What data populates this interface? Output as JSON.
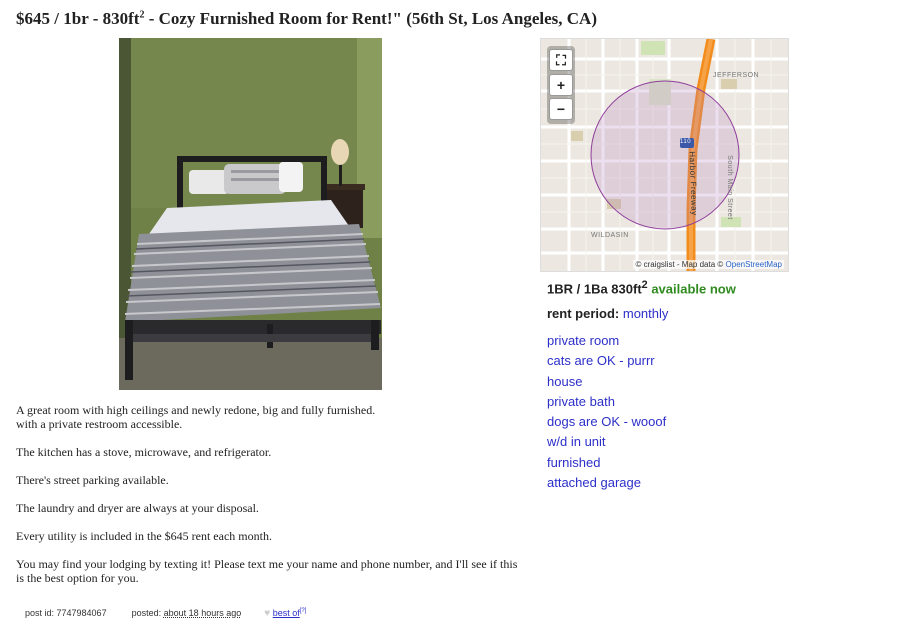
{
  "title": {
    "price": "$645",
    "rooms": "1br",
    "size": "830ft",
    "size_sup": "2",
    "name": "Cozy Furnished Room for Rent!\"",
    "location": "(56th St, Los Angeles, CA)"
  },
  "map": {
    "expand_icon": "⛶",
    "zoom_in": "+",
    "zoom_out": "−",
    "labels": {
      "jefferson": "JEFFERSON",
      "highway": "Harbor Freeway",
      "shield": "110",
      "main_street": "South Main Street",
      "wildasin": "WILDASIN"
    },
    "attribution_prefix": "© craigslist - Map data ©",
    "attribution_link": "OpenStreetMap"
  },
  "attrs": {
    "main": "1BR / 1Ba 830ft",
    "main_sup": "2",
    "availability": "available now",
    "rent_label": "rent period:",
    "rent_value": "monthly",
    "items": [
      "private room",
      "cats are OK - purrr",
      "house",
      "private bath",
      "dogs are OK - wooof",
      "w/d in unit",
      "furnished",
      "attached garage"
    ]
  },
  "body": {
    "p1_line1": "A great room with high ceilings and newly redone, big and fully furnished.",
    "p1_line2": "with a private restroom accessible.",
    "p2": "The kitchen has a stove, microwave, and refrigerator.",
    "p3": "There's street parking available.",
    "p4": "The laundry and dryer are always at your disposal.",
    "p5": "Every utility is included in the $645 rent each month.",
    "p6": "You may find your lodging by texting it! Please text me your name and phone number, and I'll see if this is the best option for you."
  },
  "footer": {
    "post_id": "post id: 7747984067",
    "posted_label": "posted:",
    "posted_value": "about 18 hours ago",
    "best_of": "best of",
    "best_of_sup": "[?]"
  },
  "colors": {
    "link": "#2c2fc8",
    "available": "#2f8a1f",
    "highway": "#f28c1c",
    "radius_circle": "#8e3d9a"
  }
}
